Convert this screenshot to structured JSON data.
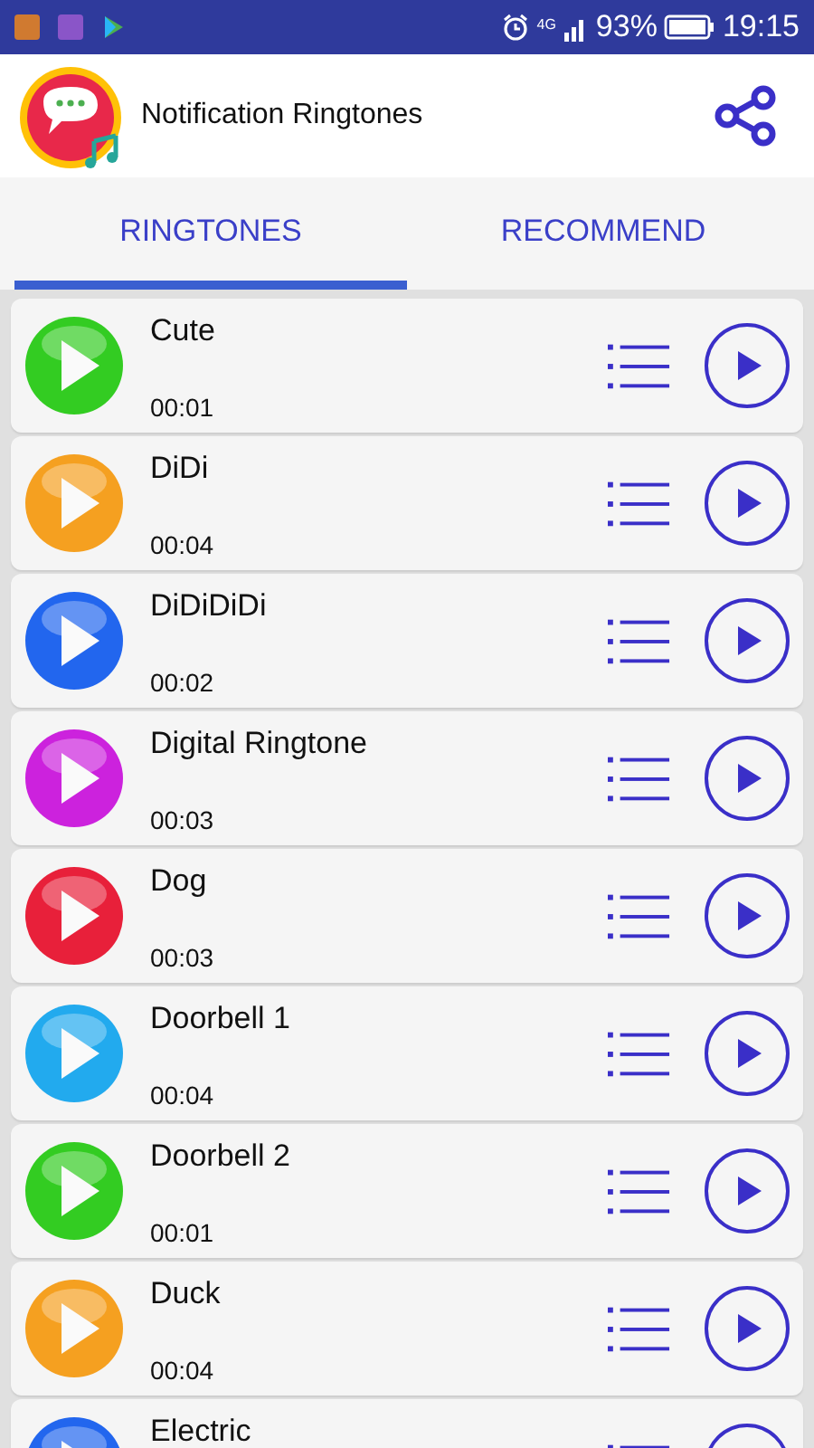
{
  "status_bar": {
    "network": "4G",
    "battery": "93%",
    "time": "19:15"
  },
  "app_bar": {
    "title": "Notification Ringtones"
  },
  "tabs": [
    {
      "label": "RINGTONES",
      "selected": true
    },
    {
      "label": "RECOMMEND",
      "selected": false
    }
  ],
  "ringtones": [
    {
      "title": "Cute",
      "duration": "00:01",
      "color": "#33cc22"
    },
    {
      "title": "DiDi",
      "duration": "00:04",
      "color": "#f5a020"
    },
    {
      "title": "DiDiDiDi",
      "duration": "00:02",
      "color": "#2266ee"
    },
    {
      "title": "Digital Ringtone",
      "duration": "00:03",
      "color": "#cc22dd"
    },
    {
      "title": "Dog",
      "duration": "00:03",
      "color": "#e8203a"
    },
    {
      "title": "Doorbell 1",
      "duration": "00:04",
      "color": "#22aaee"
    },
    {
      "title": "Doorbell 2",
      "duration": "00:01",
      "color": "#33cc22"
    },
    {
      "title": "Duck",
      "duration": "00:04",
      "color": "#f5a020"
    },
    {
      "title": "Electric",
      "color": "#2266ee"
    }
  ]
}
